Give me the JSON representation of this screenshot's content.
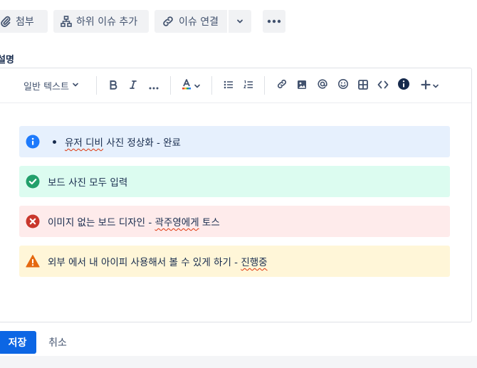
{
  "actions": {
    "attach_label": "첨부",
    "add_child_label": "하위 이슈 추가",
    "link_issue_label": "이슈 연결"
  },
  "description": {
    "label": "설명"
  },
  "toolbar": {
    "text_style": "일반 텍스트"
  },
  "panels": [
    {
      "type": "info",
      "icon": "info-icon",
      "color": "#1d7afc",
      "text_prefix": "",
      "text_squiggle": "유저 디비",
      "text_rest": " 사진 정상화 - 완료"
    },
    {
      "type": "success",
      "icon": "check-circle-icon",
      "color": "#22a06b",
      "text": "보드 사진 모두 입력"
    },
    {
      "type": "error",
      "icon": "error-icon",
      "color": "#c9372c",
      "text_prefix": "이미지 없는 보드 디자인 - ",
      "text_squiggle": "곽주영에게",
      "text_rest": " 토스"
    },
    {
      "type": "warning",
      "icon": "warning-icon",
      "color": "#e56910",
      "text_prefix": "외부 에서 내 아이피 사용해서 볼 수 있게 하기 - ",
      "text_squiggle": "진행중",
      "text_rest": ""
    }
  ],
  "footer": {
    "save_label": "저장",
    "cancel_label": "취소"
  }
}
